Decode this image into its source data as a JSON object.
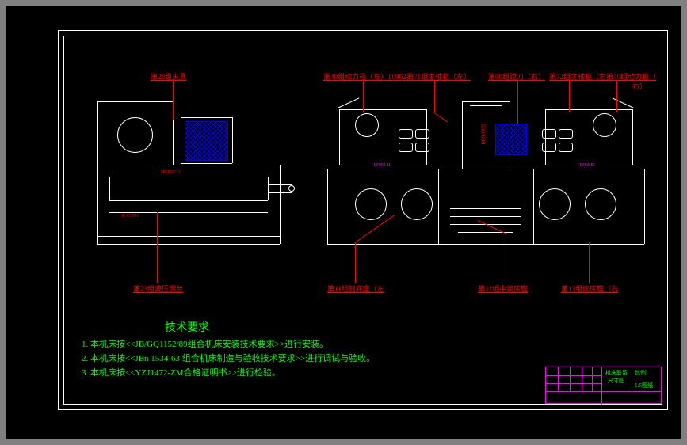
{
  "drawing": {
    "labels": {
      "l20": "第20组夹具",
      "l40": "第40组动力箱（左）T0902-I",
      "l71": "第71组主轴箱（左）",
      "l60": "第60组镗刀（右）",
      "l72": "第72组主轴箱（右第40组动力箱（",
      "l72b": "右）",
      "l23": "第23组液压滑台",
      "l11": "第11组侧底座（左",
      "l12": "第12组中间底座",
      "l13": "第13组侧底座（右",
      "side_dim": "600/600",
      "left_sub1": "1CC5718",
      "left_sub2": "HGB0712",
      "right_sub1": "1T092-II",
      "right_sub2": "1T092-II"
    },
    "requirements": {
      "title": "技术要求",
      "r1": "1. 本机床按<<JB/GQ1152/89组合机床安装技术要求>>进行安装。",
      "r2": "2. 本机床按<<JBn 1534-63 组合机床制造与验收技术要求>>进行调试与验收。",
      "r3": "3. 本机床按<<YZJ1472-ZM合格证明书>>进行检验。"
    },
    "titleblock": {
      "name": "机床联系",
      "name2": "尺寸图",
      "scale_label": "比例",
      "sheet": "1:5图纸"
    }
  }
}
